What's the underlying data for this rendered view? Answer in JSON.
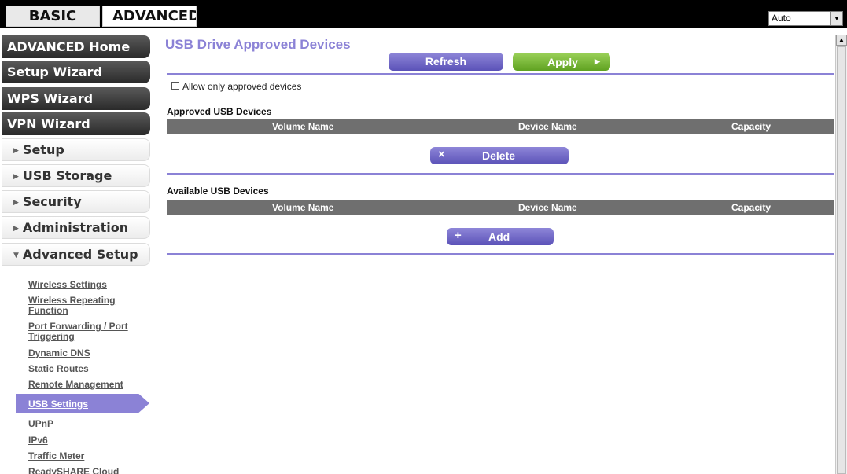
{
  "top_tabs": {
    "basic": "BASIC",
    "advanced": "ADVANCED"
  },
  "language_select": {
    "value": "Auto"
  },
  "nav": {
    "dark": [
      "ADVANCED Home",
      "Setup Wizard",
      "WPS Wizard",
      "VPN Wizard"
    ],
    "sections": [
      "Setup",
      "USB Storage",
      "Security",
      "Administration",
      "Advanced Setup"
    ],
    "advanced_setup_links": [
      "Wireless Settings",
      "Wireless Repeating",
      "Function",
      "Port Forwarding / Port",
      "Triggering",
      "Dynamic DNS",
      "Static Routes",
      "Remote Management",
      "USB Settings",
      "UPnP",
      "IPv6",
      "Traffic Meter",
      "ReadySHARE Cloud"
    ]
  },
  "main": {
    "title": "USB Drive Approved Devices",
    "refresh_label": "Refresh",
    "apply_label": "Apply",
    "allow_only_label": "Allow only approved devices",
    "approved_title": "Approved USB Devices",
    "available_title": "Available USB Devices",
    "columns": [
      "Volume Name",
      "Device Name",
      "Capacity"
    ],
    "delete_label": "Delete",
    "add_label": "Add"
  },
  "colors": {
    "accent": "#8b82d6",
    "apply_green": "#7cbf3a",
    "header_gray": "#6f6f6f"
  },
  "icons": {
    "delete": "close-x-icon",
    "add": "plus-icon",
    "apply": "arrow-right-icon"
  }
}
